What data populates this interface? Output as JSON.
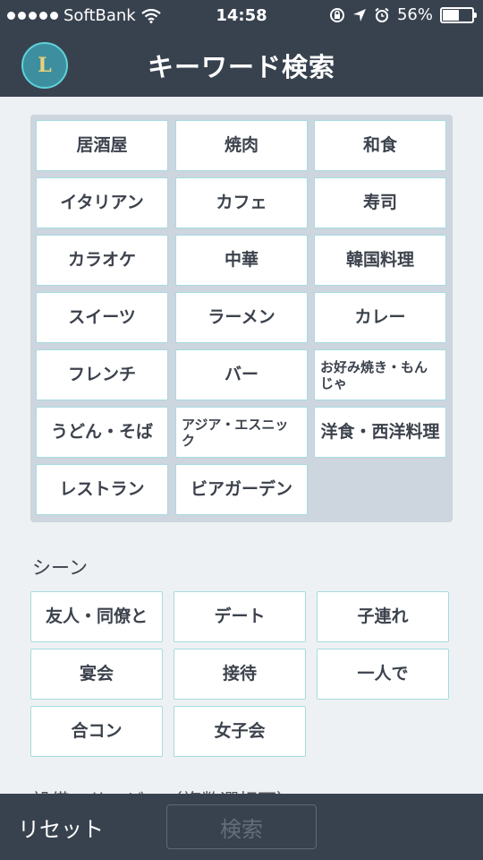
{
  "status_bar": {
    "carrier": "SoftBank",
    "time": "14:58",
    "battery_text": "56%",
    "battery_level": 0.56
  },
  "nav": {
    "title": "キーワード検索",
    "logo_letter": "L"
  },
  "genres": [
    [
      "居酒屋",
      "焼肉",
      "和食"
    ],
    [
      "イタリアン",
      "カフェ",
      "寿司"
    ],
    [
      "カラオケ",
      "中華",
      "韓国料理"
    ],
    [
      "スイーツ",
      "ラーメン",
      "カレー"
    ],
    [
      "フレンチ",
      "バー",
      "お好み焼き・もんじゃ"
    ],
    [
      "うどん・そば",
      "アジア・エスニック",
      "洋食・西洋料理"
    ],
    [
      "レストラン",
      "ビアガーデン"
    ]
  ],
  "scene": {
    "label": "シーン",
    "items": [
      [
        "友人・同僚と",
        "デート",
        "子連れ"
      ],
      [
        "宴会",
        "接待",
        "一人で"
      ],
      [
        "合コン",
        "女子会"
      ]
    ]
  },
  "next_section_label": "設備・サービス（複数選択可）",
  "bottom": {
    "reset_label": "リセット",
    "search_label": "検索"
  },
  "colors": {
    "header_bg": "#38424f",
    "button_border": "#a6dbe0",
    "panel_bg": "#cdd5de",
    "page_bg": "#eef1f3"
  }
}
